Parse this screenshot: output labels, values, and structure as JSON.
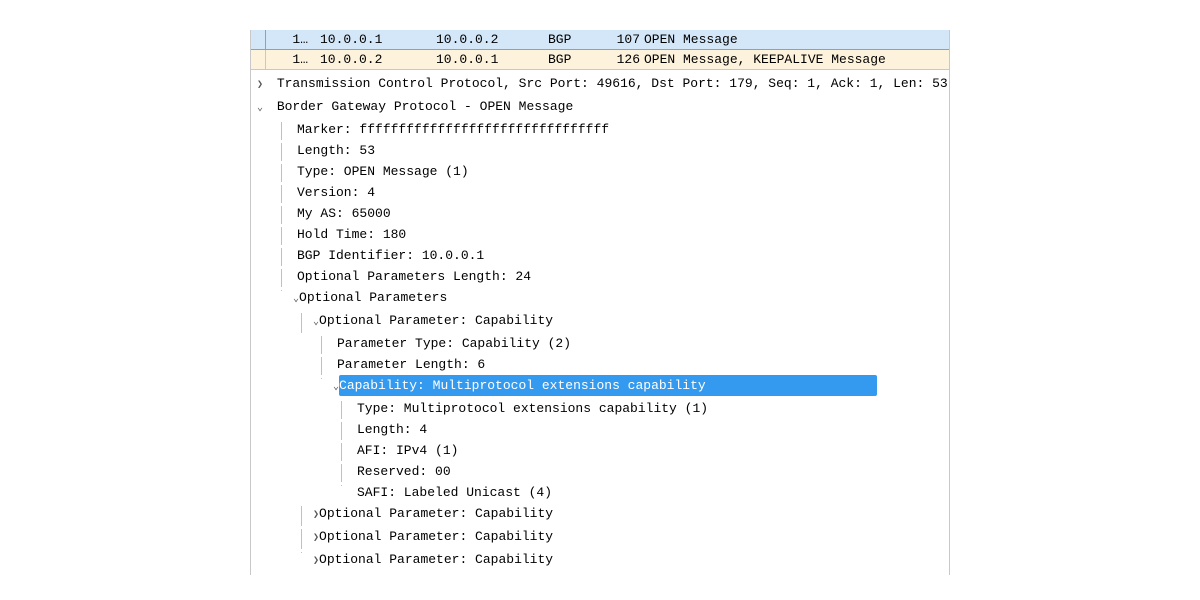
{
  "packets": [
    {
      "no": "1…",
      "src": "10.0.0.1",
      "dst": "10.0.0.2",
      "proto": "BGP",
      "len": "107",
      "info": "OPEN Message"
    },
    {
      "no": "1…",
      "src": "10.0.0.2",
      "dst": "10.0.0.1",
      "proto": "BGP",
      "len": "126",
      "info": "OPEN Message, KEEPALIVE Message"
    }
  ],
  "details": {
    "tcp": "Transmission Control Protocol, Src Port: 49616, Dst Port: 179, Seq: 1, Ack: 1, Len: 53",
    "bgp": "Border Gateway Protocol - OPEN Message",
    "marker": "Marker: ffffffffffffffffffffffffffffffff",
    "length": "Length: 53",
    "type": "Type: OPEN Message (1)",
    "version": "Version: 4",
    "myas": "My AS: 65000",
    "hold": "Hold Time: 180",
    "bgpid": "BGP Identifier: 10.0.0.1",
    "optlen": "Optional Parameters Length: 24",
    "optparams": "Optional Parameters",
    "optcap": "Optional Parameter: Capability",
    "ptype": "Parameter Type: Capability (2)",
    "plen": "Parameter Length: 6",
    "cap": "Capability: Multiprotocol extensions capability",
    "ctype": "Type: Multiprotocol extensions capability (1)",
    "clen": "Length: 4",
    "afi": "AFI: IPv4 (1)",
    "reserved": "Reserved: 00",
    "safi": "SAFI: Labeled Unicast (4)",
    "optcap2": "Optional Parameter: Capability",
    "optcap3": "Optional Parameter: Capability",
    "optcap4": "Optional Parameter: Capability"
  },
  "icons": {
    "collapsed": "❯",
    "expanded": "⌄"
  }
}
